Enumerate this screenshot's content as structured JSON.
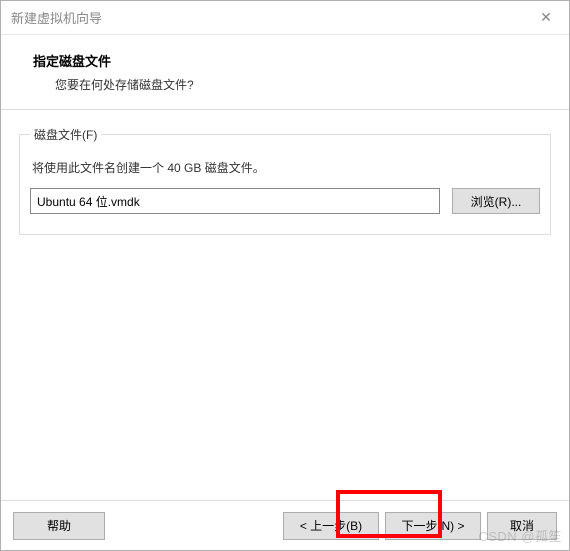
{
  "titlebar": {
    "title": "新建虚拟机向导",
    "close_label": "✕"
  },
  "header": {
    "title": "指定磁盘文件",
    "subtitle": "您要在何处存储磁盘文件?"
  },
  "group": {
    "legend": "磁盘文件(F)",
    "description": "将使用此文件名创建一个 40 GB 磁盘文件。",
    "file_value": "Ubuntu 64 位.vmdk",
    "browse_label": "浏览(R)..."
  },
  "footer": {
    "help_label": "帮助",
    "back_label": "< 上一步(B)",
    "next_label": "下一步(N) >",
    "cancel_label": "取消"
  },
  "watermark": "CSDN @孤笙"
}
